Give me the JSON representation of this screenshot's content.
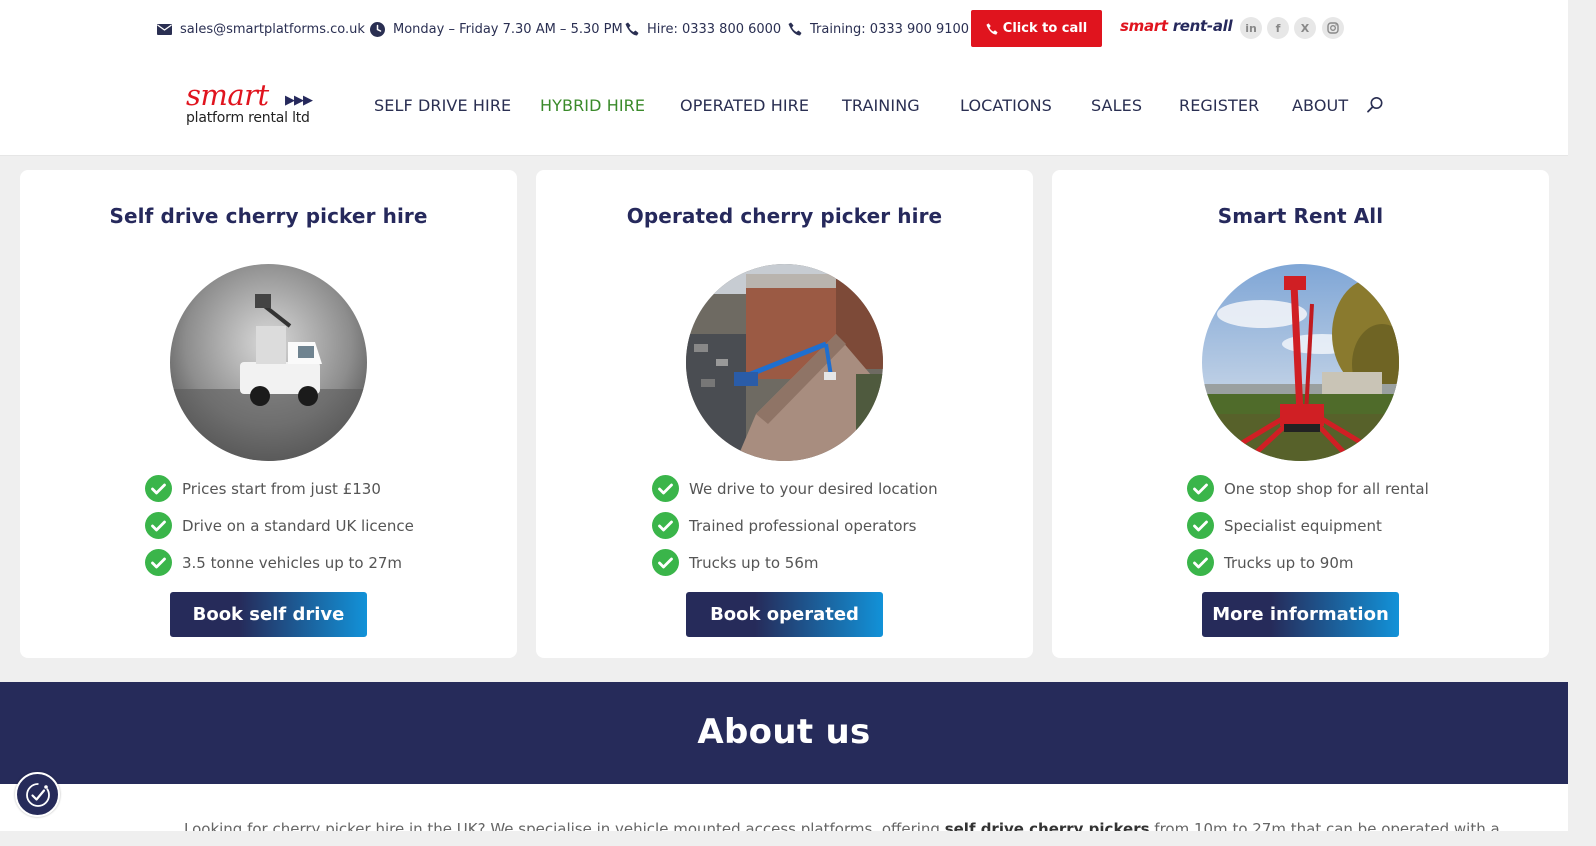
{
  "topbar": {
    "email": "sales@smartplatforms.co.uk",
    "hours": "Monday – Friday 7.30 AM – 5.30 PM",
    "hire_phone": "Hire: 0333 800 6000",
    "training_phone": "Training: 0333 900 9100",
    "call_button": "Click to call",
    "rentall_logo": {
      "part1": "smart",
      "part2": "rent-all"
    },
    "social": [
      {
        "icon": "linkedin-icon",
        "label": "in"
      },
      {
        "icon": "facebook-icon",
        "label": "f"
      },
      {
        "icon": "x-icon",
        "label": "X"
      },
      {
        "icon": "instagram-icon",
        "label": ""
      }
    ]
  },
  "header": {
    "logo": {
      "word": "smart",
      "sub": "platform rental ltd",
      "arrows": "▶▶▶"
    },
    "nav": [
      {
        "label": "SELF DRIVE HIRE",
        "active": false
      },
      {
        "label": "HYBRID HIRE",
        "active": true
      },
      {
        "label": "OPERATED HIRE",
        "active": false
      },
      {
        "label": "TRAINING",
        "active": false
      },
      {
        "label": "LOCATIONS",
        "active": false
      },
      {
        "label": "SALES",
        "active": false
      },
      {
        "label": "REGISTER",
        "active": false
      },
      {
        "label": "ABOUT",
        "active": false
      }
    ]
  },
  "cards": [
    {
      "title": "Self drive cherry picker hire",
      "features": [
        "Prices start from just £130",
        "Drive on a standard UK licence",
        "3.5 tonne vehicles up to 27m"
      ],
      "button": "Book self drive"
    },
    {
      "title": "Operated cherry picker hire",
      "features": [
        "We drive to your desired location",
        "Trained professional operators",
        "Trucks up to 56m"
      ],
      "button": "Book operated"
    },
    {
      "title": "Smart Rent All",
      "features": [
        "One stop shop for all rental",
        "Specialist equipment",
        "Trucks up to 90m"
      ],
      "button": "More information"
    }
  ],
  "about": {
    "title": "About us",
    "text_start": "Looking for cherry picker hire in the UK? We specialise in vehicle mounted access platforms, offering ",
    "text_bold": "self drive cherry pickers",
    "text_end": " from 10m to 27m that can be operated with a"
  },
  "colors": {
    "navy": "#262b5a",
    "red": "#e0141e",
    "green_check": "#3ab54a",
    "active_nav": "#3a8a2a",
    "button_gradient_end": "#1292d8"
  }
}
